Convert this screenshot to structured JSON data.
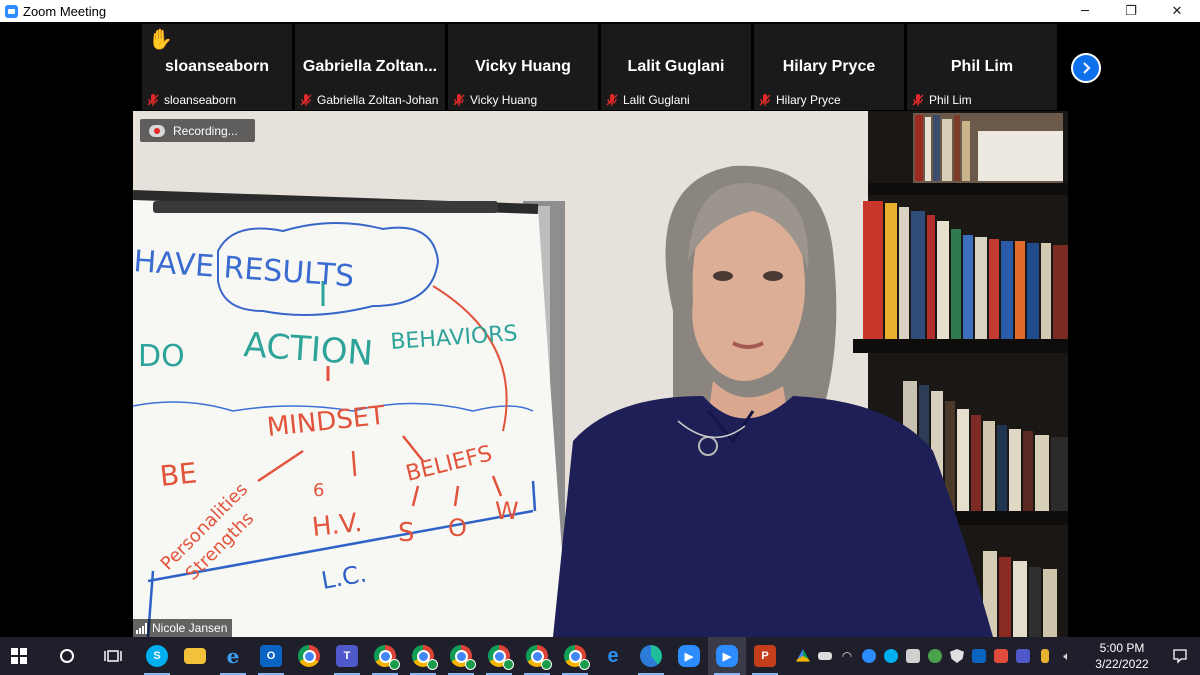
{
  "window": {
    "title": "Zoom Meeting",
    "controls": [
      "─",
      "❐",
      "✕"
    ]
  },
  "participants": [
    {
      "display": "sloanseaborn",
      "label": "sloanseaborn",
      "hand_raised": true,
      "muted": true
    },
    {
      "display": "Gabriella  Zoltan...",
      "label": "Gabriella Zoltan-Johan",
      "hand_raised": false,
      "muted": true
    },
    {
      "display": "Vicky Huang",
      "label": "Vicky Huang",
      "hand_raised": false,
      "muted": true
    },
    {
      "display": "Lalit Guglani",
      "label": "Lalit Guglani",
      "hand_raised": false,
      "muted": true
    },
    {
      "display": "Hilary Pryce",
      "label": "Hilary Pryce",
      "hand_raised": false,
      "muted": true
    },
    {
      "display": "Phil Lim",
      "label": "Phil Lim",
      "hand_raised": false,
      "muted": true
    }
  ],
  "strip": {
    "next_icon": "chevron-right-icon"
  },
  "recording": {
    "label": "Recording..."
  },
  "speaker": {
    "name": "Nicole Jansen"
  },
  "whiteboard": {
    "lines": [
      "HAVE RESULTS",
      "DO",
      "ACTION",
      "BEHAVIORS",
      "MINDSET",
      "BE",
      "BELIEFS",
      "Personalities",
      "Strengths",
      "H.V.",
      "6",
      "S",
      "O",
      "W",
      "L.C."
    ]
  },
  "taskbar": {
    "apps": [
      "windows-start",
      "cortana",
      "task-view",
      "skype",
      "file-explorer",
      "internet-explorer",
      "outlook",
      "chrome",
      "teams",
      "chrome",
      "chrome",
      "chrome",
      "chrome",
      "chrome",
      "chrome",
      "edge",
      "edge-beta",
      "zoom",
      "zoom",
      "powerpoint"
    ],
    "active_app": "zoom",
    "clock_time": "5:00 PM",
    "clock_date": "3/22/2022"
  },
  "colors": {
    "zoom_blue": "#2d8cff",
    "accent": "#0e71eb",
    "muted_red": "#e02828",
    "taskbar": "#1f1f2b"
  }
}
